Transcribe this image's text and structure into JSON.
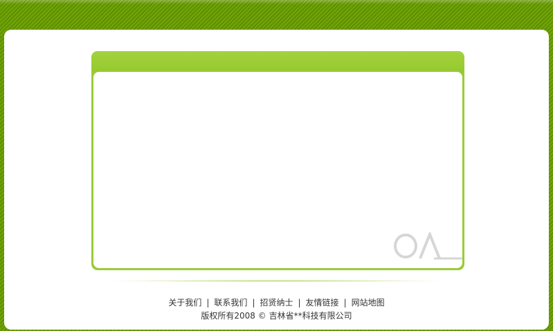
{
  "colors": {
    "frame_green": "#669900",
    "accent_green": "#99cc33",
    "panel_white": "#ffffff",
    "logo_gray": "#d6d6d6",
    "text": "#333333"
  },
  "login_box": {
    "logo_icon": "oa-logo"
  },
  "footer": {
    "links": [
      {
        "label": "关于我们"
      },
      {
        "label": "联系我们"
      },
      {
        "label": "招贤纳士"
      },
      {
        "label": "友情链接"
      },
      {
        "label": "网站地图"
      }
    ],
    "separator": "|",
    "copyright": "版权所有2008 © 吉林省**科技有限公司"
  }
}
